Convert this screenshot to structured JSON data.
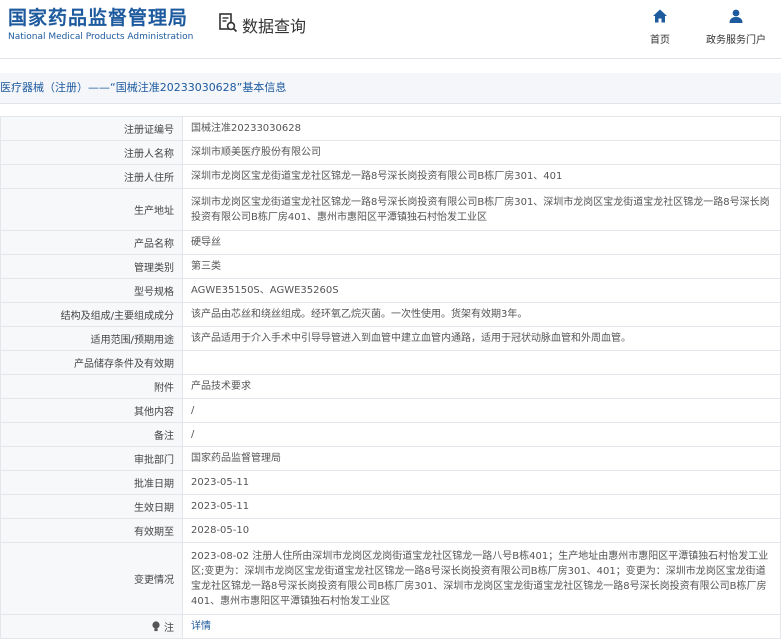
{
  "header": {
    "logo_cn": "国家药品监督管理局",
    "logo_en": "National Medical Products Administration",
    "query_title": "数据查询",
    "query_icon": "magnifier-document-icon",
    "nav": [
      {
        "label": "首页",
        "icon": "home-icon"
      },
      {
        "label": "政务服务门户",
        "icon": "user-icon"
      }
    ]
  },
  "breadcrumb": "医疗器械（注册）——“国械注准20233030628”基本信息",
  "rows": [
    {
      "label": "注册证编号",
      "value": "国械注准20233030628"
    },
    {
      "label": "注册人名称",
      "value": "深圳市顺美医疗股份有限公司"
    },
    {
      "label": "注册人住所",
      "value": "深圳市龙岗区宝龙街道宝龙社区锦龙一路8号深长岗投资有限公司B栋厂房301、401"
    },
    {
      "label": "生产地址",
      "value": "深圳市龙岗区宝龙街道宝龙社区锦龙一路8号深长岗投资有限公司B栋厂房301、深圳市龙岗区宝龙街道宝龙社区锦龙一路8号深长岗投资有限公司B栋厂房401、惠州市惠阳区平潭镇独石村怡发工业区"
    },
    {
      "label": "产品名称",
      "value": "硬导丝"
    },
    {
      "label": "管理类别",
      "value": "第三类"
    },
    {
      "label": "型号规格",
      "value": "AGWE35150S、AGWE35260S"
    },
    {
      "label": "结构及组成/主要组成成分",
      "value": "该产品由芯丝和绕丝组成。经环氧乙烷灭菌。一次性使用。货架有效期3年。"
    },
    {
      "label": "适用范围/预期用途",
      "value": "该产品适用于介入手术中引导导管进入到血管中建立血管内通路，适用于冠状动脉血管和外周血管。"
    },
    {
      "label": "产品储存条件及有效期",
      "value": ""
    },
    {
      "label": "附件",
      "value": "产品技术要求"
    },
    {
      "label": "其他内容",
      "value": "/"
    },
    {
      "label": "备注",
      "value": "/"
    },
    {
      "label": "审批部门",
      "value": "国家药品监督管理局"
    },
    {
      "label": "批准日期",
      "value": "2023-05-11"
    },
    {
      "label": "生效日期",
      "value": "2023-05-11"
    },
    {
      "label": "有效期至",
      "value": "2028-05-10"
    },
    {
      "label": "变更情况",
      "value": "2023-08-02 注册人住所由深圳市龙岗区龙岗街道宝龙社区锦龙一路八号B栋401；生产地址由惠州市惠阳区平潭镇独石村怡发工业区;变更为：深圳市龙岗区宝龙街道宝龙社区锦龙一路8号深长岗投资有限公司B栋厂房301、401；变更为：深圳市龙岗区宝龙街道宝龙社区锦龙一路8号深长岗投资有限公司B栋厂房301、深圳市龙岗区宝龙街道宝龙社区锦龙一路8号深长岗投资有限公司B栋厂房401、惠州市惠阳区平潭镇独石村怡发工业区"
    }
  ],
  "note_row": {
    "label": "注",
    "icon": "bulb-icon",
    "link": "详情"
  }
}
